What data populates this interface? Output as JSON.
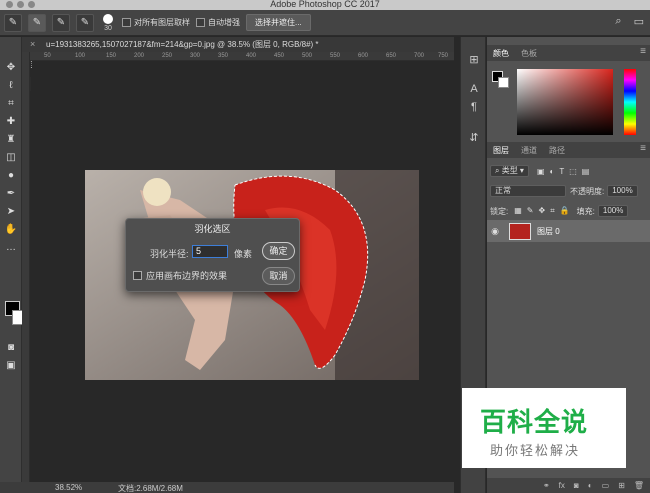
{
  "app": {
    "title": "Adobe Photoshop CC 2017"
  },
  "options": {
    "brush_size": "30",
    "sample_all_label": "对所有图层取样",
    "auto_enhance_label": "自动增强",
    "select_mask_label": "选择并遮住..."
  },
  "document": {
    "tab_title": "u=1931383265,1507027187&fm=214&gp=0.jpg @ 38.5% (图层 0, RGB/8#) *",
    "close_glyph": "×"
  },
  "ruler": {
    "ticks": [
      "50",
      "100",
      "150",
      "200",
      "250",
      "300",
      "350",
      "400",
      "450",
      "500",
      "550",
      "600",
      "650",
      "700",
      "750"
    ]
  },
  "dialog": {
    "title": "羽化选区",
    "radius_label": "羽化半径:",
    "radius_value": "5",
    "unit": "像素",
    "checkbox_label": "应用画布边界的效果",
    "ok": "确定",
    "cancel": "取消"
  },
  "status": {
    "zoom": "38.52%",
    "doc": "文档:2.68M/2.68M"
  },
  "panels": {
    "color_tabs": [
      "颜色",
      "色板"
    ],
    "layer_tabs": [
      "图层",
      "通道",
      "路径"
    ],
    "filter_kind": "类型",
    "blend_mode": "正常",
    "opacity_label": "不透明度:",
    "opacity": "100%",
    "lock_label": "锁定:",
    "fill_label": "填充:",
    "fill": "100%",
    "layer_name": "图层 0"
  },
  "watermark": {
    "line1": "百科全说",
    "line2": "助你轻松解决"
  },
  "colors": {
    "accent": "#3d7ed8",
    "canvas_red": "#c8221b"
  }
}
